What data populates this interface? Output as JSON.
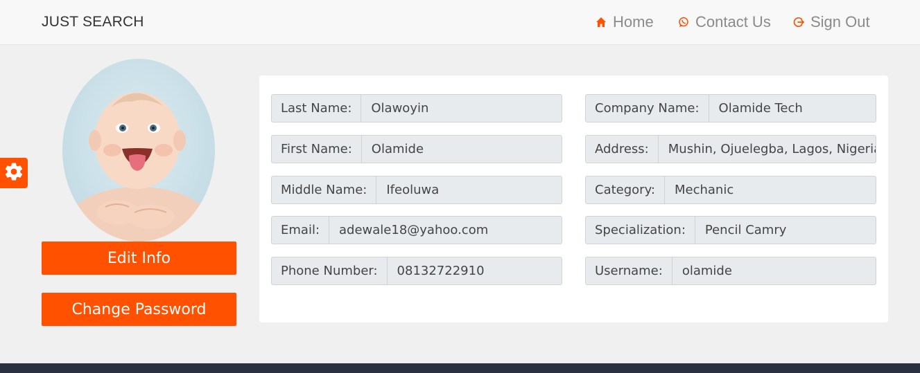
{
  "nav": {
    "brand": "JUST SEARCH",
    "links": [
      {
        "label": "Home",
        "icon": "home-icon"
      },
      {
        "label": "Contact Us",
        "icon": "whatsapp-icon"
      },
      {
        "label": "Sign Out",
        "icon": "sign-out-icon"
      }
    ]
  },
  "colors": {
    "accent": "#ff5100",
    "footer": "#2a3140"
  },
  "sidebar": {
    "edit_label": "Edit Info",
    "password_label": "Change Password",
    "settings_icon": "gear-icon"
  },
  "profile": {
    "left": [
      {
        "label": "Last Name:",
        "value": "Olawoyin"
      },
      {
        "label": "First Name:",
        "value": "Olamide"
      },
      {
        "label": "Middle Name:",
        "value": "Ifeoluwa"
      },
      {
        "label": "Email:",
        "value": "adewale18@yahoo.com"
      },
      {
        "label": "Phone Number:",
        "value": "08132722910"
      }
    ],
    "right": [
      {
        "label": "Company Name:",
        "value": "Olamide Tech"
      },
      {
        "label": "Address:",
        "value": "Mushin, Ojuelegba, Lagos, Nigeria"
      },
      {
        "label": "Category:",
        "value": " Mechanic"
      },
      {
        "label": "Specialization:",
        "value": "Pencil Camry"
      },
      {
        "label": "Username:",
        "value": "olamide"
      }
    ]
  }
}
